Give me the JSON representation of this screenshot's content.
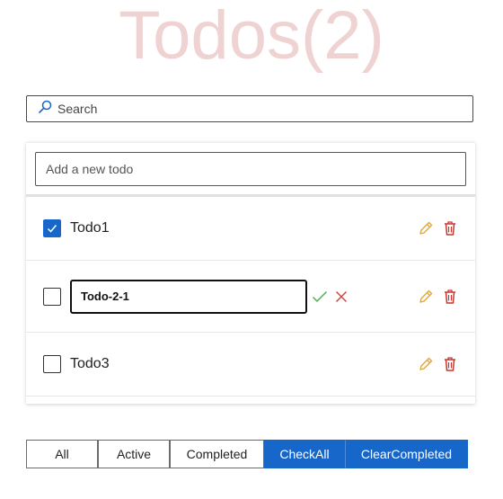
{
  "header": {
    "title": "Todos(2)"
  },
  "search": {
    "placeholder": "Search"
  },
  "add": {
    "placeholder": "Add a new todo"
  },
  "todos": [
    {
      "label": "Todo1",
      "checked": true
    },
    {
      "edit_value": "Todo-2-1",
      "checked": false
    },
    {
      "label": "Todo3",
      "checked": false
    }
  ],
  "filters": {
    "all": "All",
    "active": "Active",
    "completed": "Completed",
    "check_all": "CheckAll",
    "clear_completed": "ClearCompleted"
  },
  "colors": {
    "primary": "#1766c9",
    "pencil": "#e0a63a",
    "trash": "#c8362f",
    "confirm": "#4caf50",
    "cancel": "#d0443e",
    "title": "#efd3d3"
  }
}
